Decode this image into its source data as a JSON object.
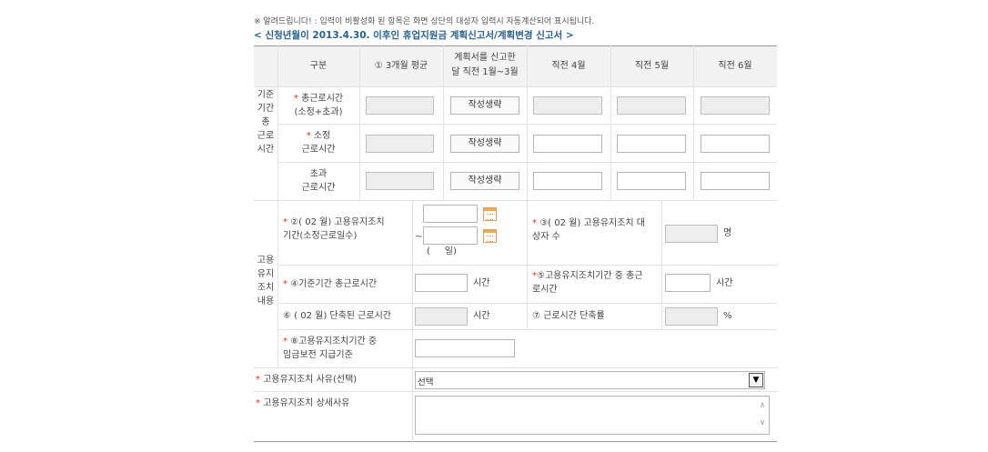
{
  "notice": "※ 알려드립니다! : 입력이 비활성화 된 항목은 화면 상단의 대상자 입력시 자동계산되어 표시됩니다.",
  "subtitle": "< 신청년월이 2013.4.30. 이후인 휴업지원금 계획신고서/계획변경 신고서 >",
  "required_mark": "*",
  "table_header": {
    "category": "구분",
    "avg3": "① 3개월 평균",
    "plan_line1": "계획서를 신고한",
    "plan_line2": "달 직전 1월~3월",
    "prev4": "직전 4월",
    "prev5": "직전 5월",
    "prev6": "직전 6월"
  },
  "section1": {
    "label_lines": [
      "기준",
      "기간",
      "총",
      "근로",
      "시간"
    ],
    "rows": [
      {
        "line1": "총근로시간",
        "line2": "(소정+초과)",
        "required": true,
        "button": "작성생략"
      },
      {
        "line1": "소정",
        "line2": "근로시간",
        "required": true,
        "button": "작성생략"
      },
      {
        "line1": "초과",
        "line2": "근로시간",
        "required": false,
        "button": "작성생략"
      }
    ]
  },
  "section2": {
    "label_lines": [
      "고용",
      "유지",
      "조치",
      "내용"
    ],
    "period_label_line1": "②( 02 월) 고용유지조치",
    "period_label_line2": "기간(소정근로일수)",
    "tilde": "~",
    "days_text": "(     일)",
    "target_label_line1": "③( 02 월) 고용유지조치 대",
    "target_label_line2": "상자 수",
    "target_unit": "명",
    "base_hours_label": "④기준기간 총근로시간",
    "base_hours_unit": "시간",
    "during_hours_line1": "⑤고용유지조치기간 중 총근",
    "during_hours_line2": "로시간",
    "during_hours_unit": "시간",
    "reduced_label": "⑥ ( 02 월) 단축된 근로시간",
    "reduced_unit": "시간",
    "reduction_rate_label": "⑦ 근로시간 단축률",
    "reduction_rate_unit": "%",
    "wage_label_line1": "⑧고용유지조치기간 중",
    "wage_label_line2": "임금보전 지급기준"
  },
  "reason_select_label": "고용유지조치 사유(선택)",
  "reason_select_value": "선택",
  "reason_detail_label": "고용유지조치 상세사유",
  "icons": {
    "calendar": "calendar-icon",
    "dropdown": "chevron-down-icon",
    "scroll_up": "scroll-up-icon",
    "scroll_down": "scroll-down-icon"
  },
  "colors": {
    "subtitle": "#27618e",
    "required": "#d6302a",
    "disabled_input": "#eeeeee",
    "header_bg": "#f2f2f2"
  }
}
